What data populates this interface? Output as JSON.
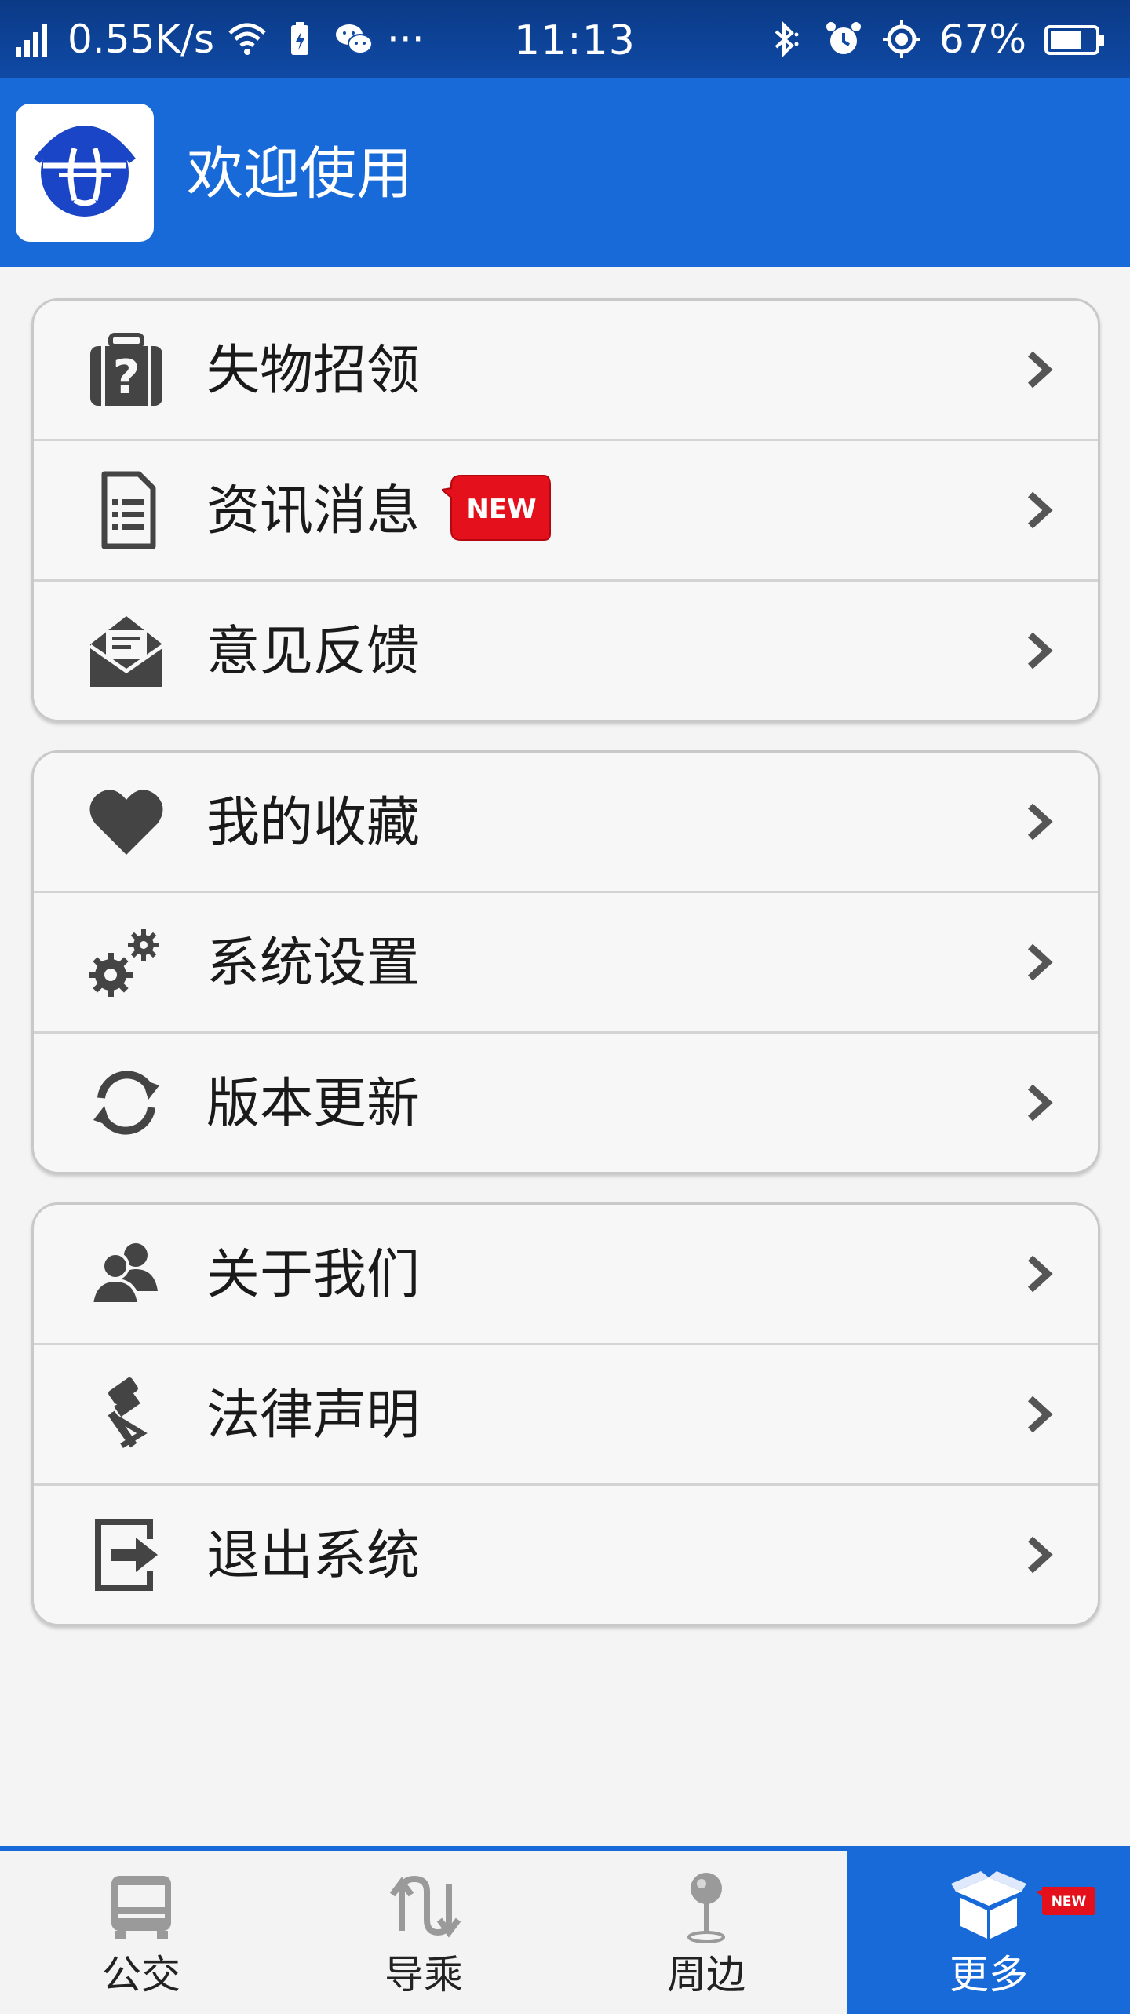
{
  "status_bar": {
    "speed": "0.55K/s",
    "time": "11:13",
    "battery": "67%",
    "more": "···"
  },
  "header": {
    "title": "欢迎使用"
  },
  "colors": {
    "primary": "#186ad9",
    "badge_red": "#e4101c",
    "icon_gray": "#444444"
  },
  "menu_groups": [
    {
      "items": [
        {
          "label": "失物招领",
          "icon": "lost-luggage-icon"
        },
        {
          "label": "资讯消息",
          "icon": "news-document-icon",
          "badge": "NEW"
        },
        {
          "label": "意见反馈",
          "icon": "feedback-envelope-icon"
        }
      ]
    },
    {
      "items": [
        {
          "label": "我的收藏",
          "icon": "heart-icon"
        },
        {
          "label": "系统设置",
          "icon": "gears-icon"
        },
        {
          "label": "版本更新",
          "icon": "refresh-icon"
        }
      ]
    },
    {
      "items": [
        {
          "label": "关于我们",
          "icon": "users-icon"
        },
        {
          "label": "法律声明",
          "icon": "gavel-icon"
        },
        {
          "label": "退出系统",
          "icon": "logout-icon"
        }
      ]
    }
  ],
  "tabs": [
    {
      "label": "公交",
      "icon": "bus-icon"
    },
    {
      "label": "导乘",
      "icon": "route-icon"
    },
    {
      "label": "周边",
      "icon": "pin-icon"
    },
    {
      "label": "更多",
      "icon": "box-icon",
      "badge": "NEW",
      "active": true
    }
  ]
}
